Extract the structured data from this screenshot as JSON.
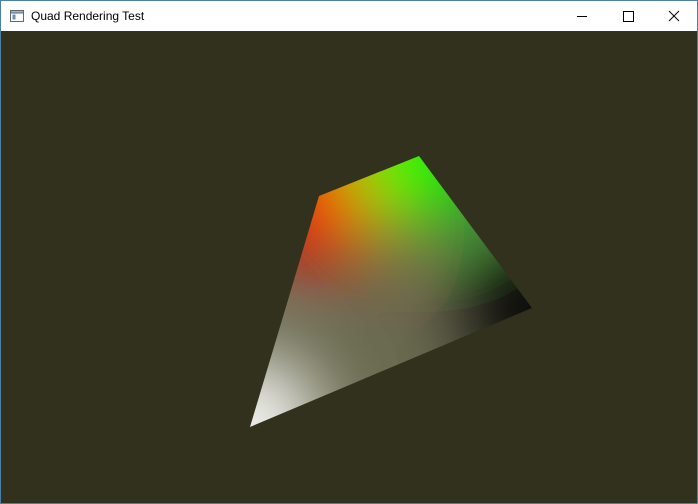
{
  "window": {
    "title": "Quad Rendering Test",
    "app_icon": "window-app-icon",
    "controls": {
      "minimize_icon": "minimize-icon",
      "maximize_icon": "maximize-icon",
      "close_icon": "close-icon"
    }
  },
  "scene": {
    "clear_color": "#31311d",
    "quad": {
      "vertex_colors": {
        "top_left": "#ff0000",
        "top_right": "#00ff00",
        "bottom_right": "#000000",
        "bottom_left": "#ffffff"
      }
    }
  }
}
